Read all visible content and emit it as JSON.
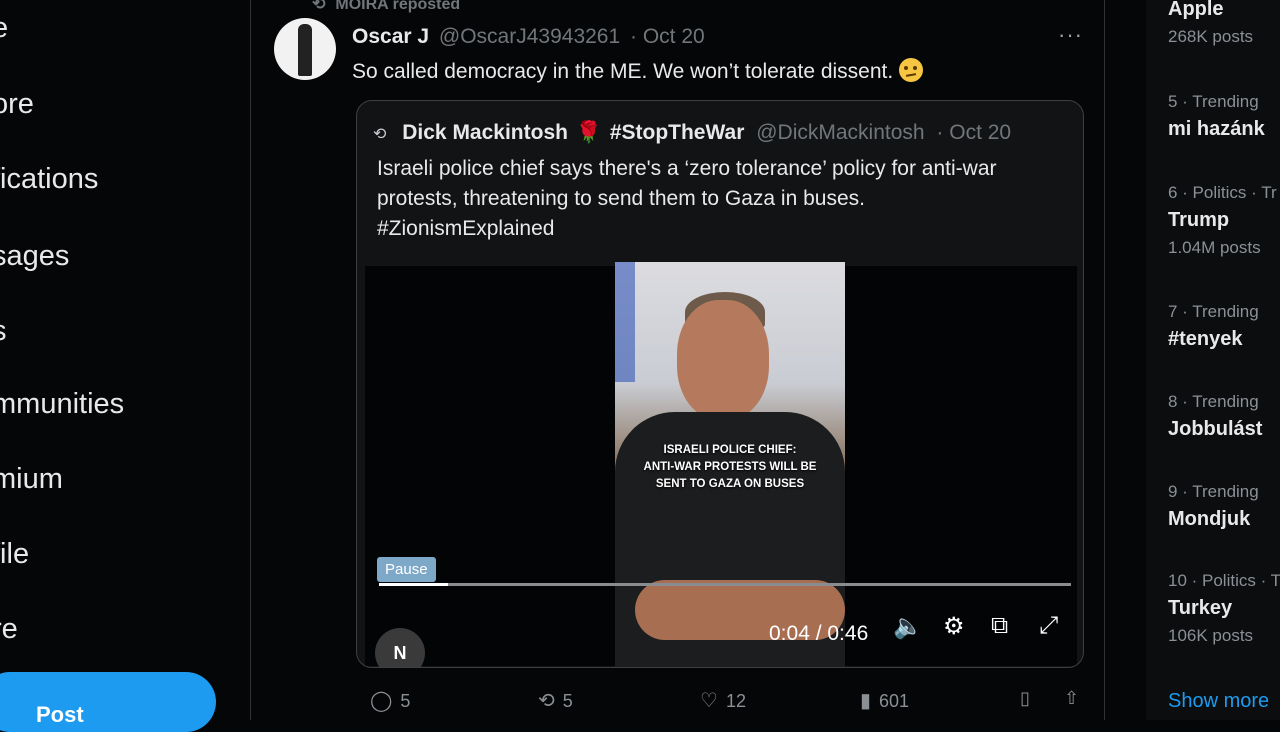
{
  "nav": {
    "items": [
      "e",
      "ore",
      "fications",
      "sages",
      "s",
      "mmunities",
      "mium",
      "file",
      "re"
    ],
    "post_label": "Post"
  },
  "tweet": {
    "repost_text": "MOIRA reposted",
    "author_name": "Oscar J",
    "author_handle": "@OscarJ43943261",
    "date": "· Oct 20",
    "more": "···",
    "text": "So called democracy in the ME. We won’t tolerate dissent.",
    "quote": {
      "author_name": "Dick Mackintosh",
      "hashtag_name": "#StopTheWar",
      "author_handle": "@DickMackintosh",
      "date": "· Oct 20",
      "text_line1": "Israeli police chief says there's a ‘zero tolerance’ policy for anti-war",
      "text_line2": "protests, threatening to send them to Gaza in buses.",
      "text_line3": "#ZionismExplained",
      "video": {
        "caption_line1": "ISRAELI POLICE CHIEF:",
        "caption_line2": "ANTI-WAR PROTESTS WILL BE",
        "caption_line3": "SENT TO GAZA ON BUSES",
        "pause_tooltip": "Pause",
        "time": "0:04 / 0:46",
        "progress": 0.1,
        "badge": "N"
      }
    },
    "stats": {
      "replies": "5",
      "reposts": "5",
      "likes": "12",
      "views": "601"
    }
  },
  "trends": [
    {
      "meta": "",
      "title": "Apple",
      "posts": "268K posts"
    },
    {
      "meta": "5 · Trending",
      "title": "mi hazánk",
      "posts": ""
    },
    {
      "meta": "6 · Politics · Tr",
      "title": "Trump",
      "posts": "1.04M posts"
    },
    {
      "meta": "7 · Trending",
      "title": "#tenyek",
      "posts": ""
    },
    {
      "meta": "8 · Trending",
      "title": "Jobbulást",
      "posts": ""
    },
    {
      "meta": "9 · Trending",
      "title": "Mondjuk",
      "posts": ""
    },
    {
      "meta": "10 · Politics · T",
      "title": "Turkey",
      "posts": "106K posts"
    }
  ],
  "show_more": "Show more",
  "colors": {
    "accent": "#1d9bf0",
    "background": "#050607",
    "muted": "#71767b"
  }
}
